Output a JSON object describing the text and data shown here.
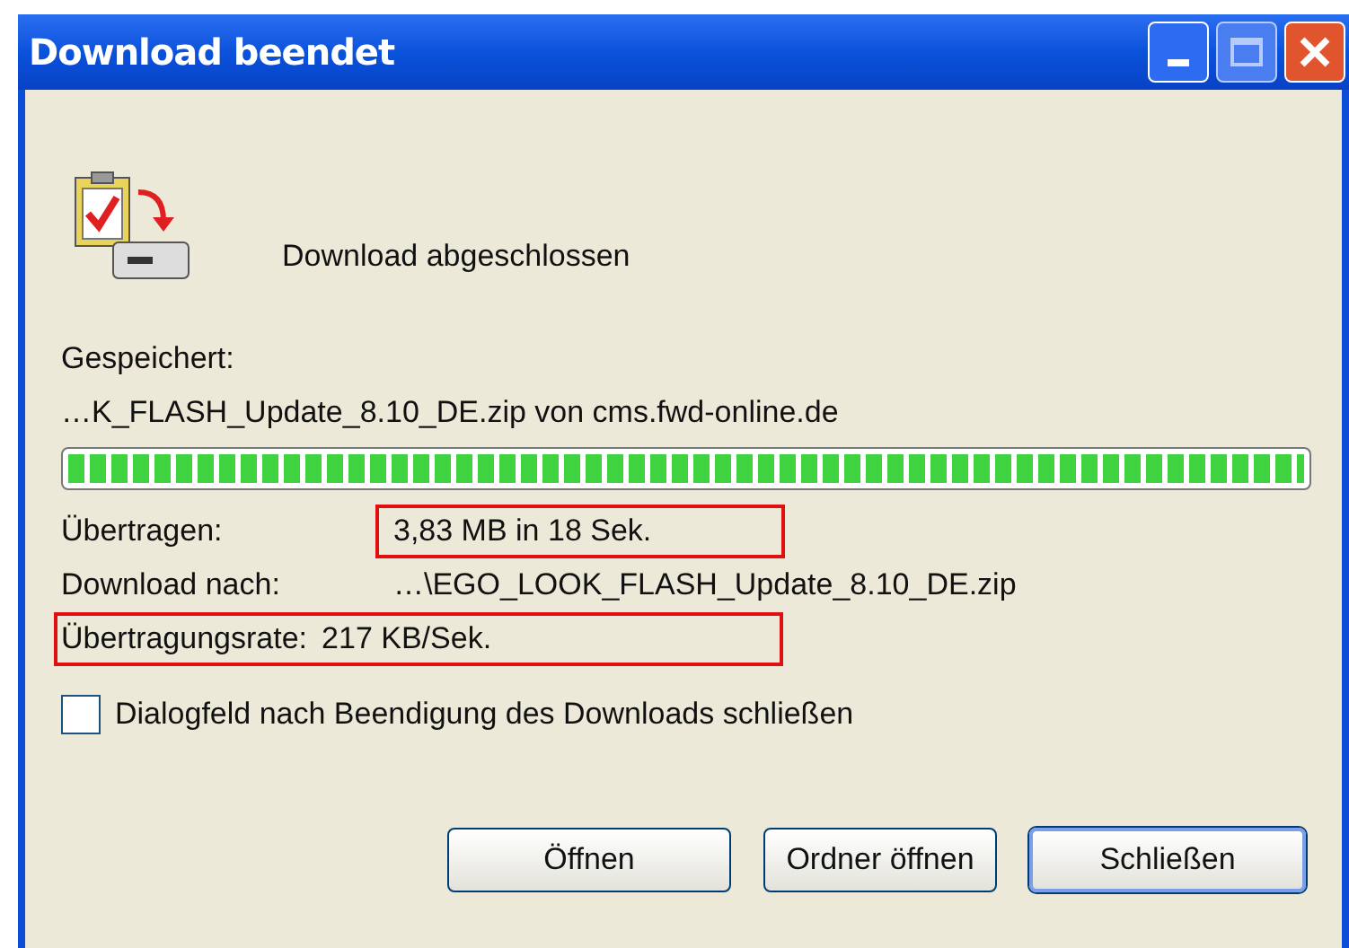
{
  "window": {
    "title": "Download beendet"
  },
  "status": "Download abgeschlossen",
  "saved_label": "Gespeichert:",
  "source": "…K_FLASH_Update_8.10_DE.zip von cms.fwd-online.de",
  "progress": {
    "level": 1
  },
  "details": [
    {
      "label": "Übertragen:",
      "value": "3,83 MB in 18 Sek.",
      "value_boxed": true,
      "row_boxed": false
    },
    {
      "label": "Download nach:",
      "value": "…\\EGO_LOOK_FLASH_Update_8.10_DE.zip",
      "value_boxed": false,
      "row_boxed": false
    },
    {
      "label": "Übertragungsrate:",
      "value": "217 KB/Sek.",
      "value_boxed": false,
      "row_boxed": true
    }
  ],
  "close_when_done": {
    "label": "Dialogfeld nach Beendigung des Downloads schließen",
    "checked": false
  },
  "buttons": [
    {
      "label": "Öffnen",
      "selected": false
    },
    {
      "label": "Ordner öffnen",
      "selected": false
    },
    {
      "label": "Schließen",
      "selected": true
    }
  ]
}
